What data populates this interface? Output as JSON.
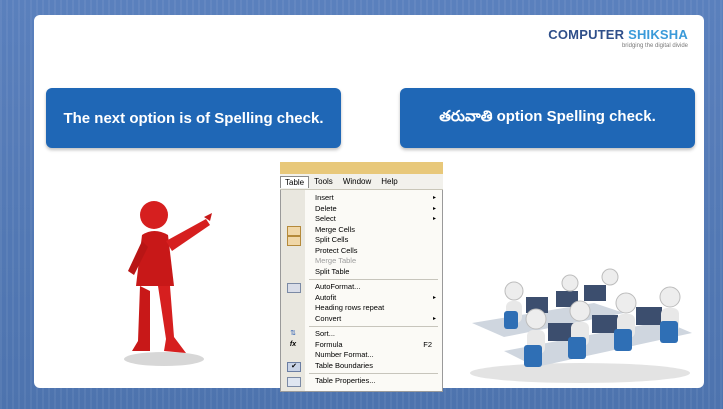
{
  "logo": {
    "main_a": "COMPUTER ",
    "main_b": "SHIKSHA",
    "tagline": "bridging the digital divide"
  },
  "callout_left": "The next option is of Spelling check.",
  "callout_right": "తరువాతి option Spelling check.",
  "menubar": [
    "Table",
    "Tools",
    "Window",
    "Help"
  ],
  "menu_items": [
    {
      "label": "Insert",
      "sub": "▸"
    },
    {
      "label": "Delete",
      "sub": "▸"
    },
    {
      "label": "Select",
      "sub": "▸"
    },
    {
      "label": "Merge Cells"
    },
    {
      "label": "Split Cells"
    },
    {
      "label": "Protect Cells"
    },
    {
      "label": "Merge Table",
      "disabled": true
    },
    {
      "label": "Split Table"
    },
    {
      "label": "AutoFormat..."
    },
    {
      "label": "Autofit",
      "sub": "▸"
    },
    {
      "label": "Heading rows repeat"
    },
    {
      "label": "Convert",
      "sub": "▸"
    },
    {
      "label": "Sort..."
    },
    {
      "label": "Formula",
      "shortcut": "F2"
    },
    {
      "label": "Number Format..."
    },
    {
      "label": "Table Boundaries"
    },
    {
      "label": "Table Properties..."
    }
  ],
  "colors": {
    "callout": "#1f67b6",
    "background": "#5b7fb8"
  }
}
